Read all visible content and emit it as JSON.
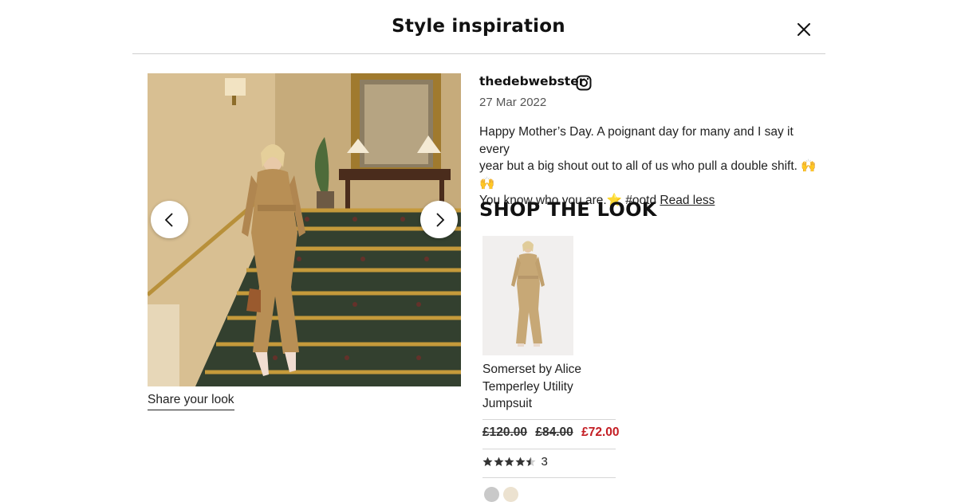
{
  "header": {
    "title": "Style inspiration",
    "close_icon": "close-icon"
  },
  "gallery": {
    "prev_icon": "chevron-left-icon",
    "next_icon": "chevron-right-icon",
    "share_label": "Share your look"
  },
  "post": {
    "username": "thedebwebster",
    "social_icon": "instagram-icon",
    "date": "27 Mar 2022",
    "caption_line1": "Happy Mother’s Day. A poignant day for many and I say it every",
    "caption_line2": "year but a big shout out to all of us who pull a double shift. 🙌🙌",
    "caption_line3": "You know who you are.⭐ #ootd",
    "read_less": "Read less"
  },
  "shop": {
    "heading": "SHOP THE LOOK",
    "product": {
      "name": "Somerset by Alice Temperley Utility Jumpsuit",
      "price_original": "£120.00",
      "price_was": "£84.00",
      "price_now": "£72.00",
      "rating": 4.5,
      "review_count": "3",
      "swatch_colors": [
        "#c9c9c9",
        "#ece2d0"
      ]
    }
  },
  "colors": {
    "sale": "#c41e24",
    "divider": "#cfcfcf"
  }
}
